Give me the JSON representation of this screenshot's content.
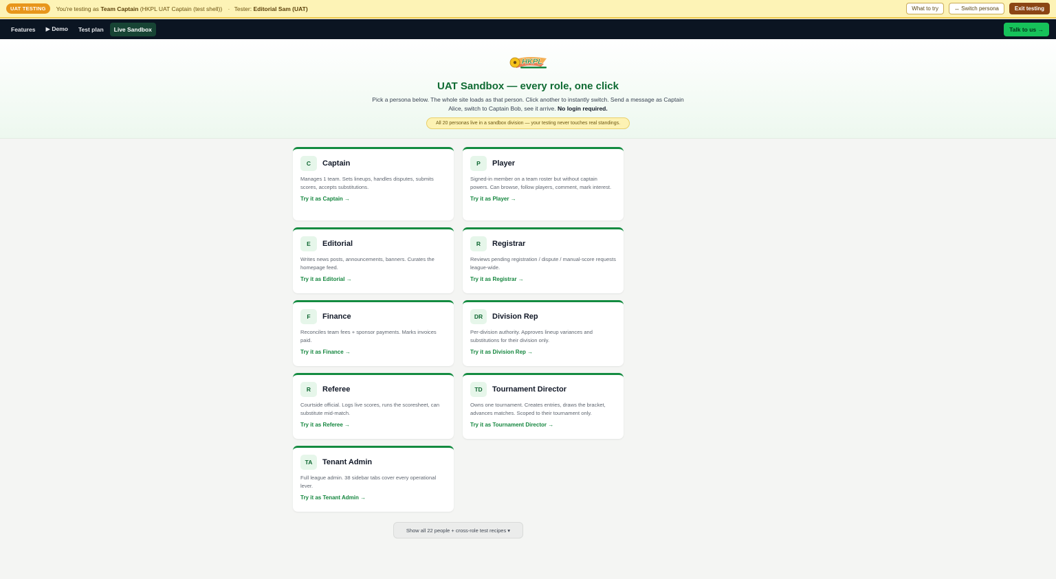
{
  "uat_bar": {
    "badge": "UAT TESTING",
    "testing_prefix": "You're testing as",
    "persona": "Team Captain",
    "persona_detail": "(HKPL UAT Captain (test shell))",
    "separator": "·",
    "tester_label": "Tester:",
    "tester_name": "Editorial Sam (UAT)",
    "what_to_try": "What to try",
    "switch_persona": "↔ Switch persona",
    "exit_testing": "Exit testing"
  },
  "nav": {
    "features": "Features",
    "demo": "▶ Demo",
    "test_plan": "Test plan",
    "live_sandbox": "Live Sandbox",
    "talk_to_us": "Talk to us →"
  },
  "hero": {
    "logo_text": "HKPL",
    "title": "UAT Sandbox — every role, one click",
    "description": "Pick a persona below. The whole site loads as that person. Click another to instantly switch. Send a message as Captain Alice, switch to Captain Bob, see it arrive.",
    "description_bold": "No login required.",
    "pill": "All 20 personas live in a sandbox division — your testing never touches real standings."
  },
  "roles": [
    {
      "initials": "C",
      "name": "Captain",
      "desc": "Manages 1 team. Sets lineups, handles disputes, submits scores, accepts substitutions.",
      "link": "Try it as Captain →"
    },
    {
      "initials": "P",
      "name": "Player",
      "desc": "Signed-in member on a team roster but without captain powers. Can browse, follow players, comment, mark interest.",
      "link": "Try it as Player →"
    },
    {
      "initials": "E",
      "name": "Editorial",
      "desc": "Writes news posts, announcements, banners. Curates the homepage feed.",
      "link": "Try it as Editorial →"
    },
    {
      "initials": "R",
      "name": "Registrar",
      "desc": "Reviews pending registration / dispute / manual-score requests league-wide.",
      "link": "Try it as Registrar →"
    },
    {
      "initials": "F",
      "name": "Finance",
      "desc": "Reconciles team fees + sponsor payments. Marks invoices paid.",
      "link": "Try it as Finance →"
    },
    {
      "initials": "DR",
      "name": "Division Rep",
      "desc": "Per-division authority. Approves lineup variances and substitutions for their division only.",
      "link": "Try it as Division Rep →"
    },
    {
      "initials": "R",
      "name": "Referee",
      "desc": "Courtside official. Logs live scores, runs the scoresheet, can substitute mid-match.",
      "link": "Try it as Referee →"
    },
    {
      "initials": "TD",
      "name": "Tournament Director",
      "desc": "Owns one tournament. Creates entries, draws the bracket, advances matches. Scoped to their tournament only.",
      "link": "Try it as Tournament Director →"
    },
    {
      "initials": "TA",
      "name": "Tenant Admin",
      "desc": "Full league admin. 38 sidebar tabs cover every operational lever.",
      "link": "Try it as Tenant Admin →"
    }
  ],
  "show_all": "Show all 22 people + cross-role test recipes ▾",
  "colors": {
    "accent": "#138b40",
    "nav_bg": "#0b1522",
    "banner_bg": "#fdf3b6",
    "cta": "#16c25a"
  }
}
